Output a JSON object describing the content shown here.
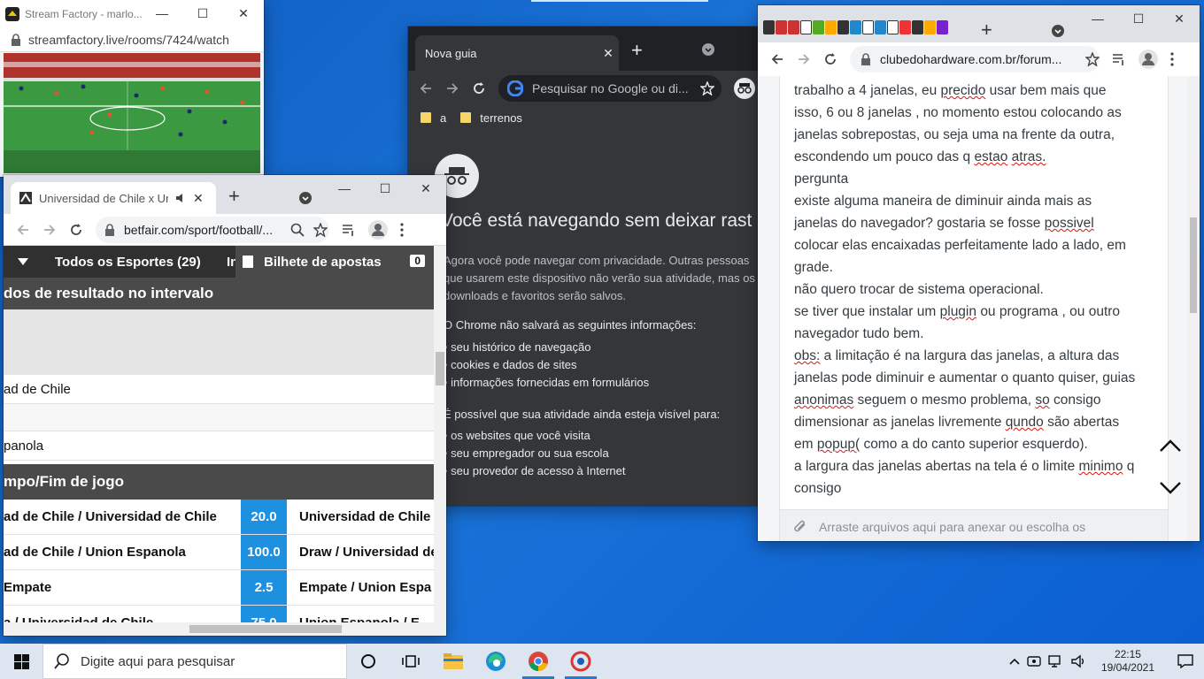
{
  "stream_window": {
    "title": "Stream Factory - marlo...",
    "url": "streamfactory.live/rooms/7424/watch"
  },
  "incognito_window": {
    "tab_title": "Nova guia",
    "omnibox_placeholder": "Pesquisar no Google ou di...",
    "bookmarks": [
      "a",
      "terrenos"
    ],
    "headline": "Você está navegando sem deixar rast",
    "intro": "Agora você pode navegar com privacidade. Outras pessoas que usarem este dispositivo não verão sua atividade, mas os downloads e favoritos serão salvos.",
    "not_saved_heading": "O Chrome não salvará as seguintes informações:",
    "not_saved_items": [
      "seu histórico de navegação",
      "cookies e dados de sites",
      "informações fornecidas em formulários"
    ],
    "visible_heading": "É possível que sua atividade ainda esteja visível para:",
    "visible_items": [
      "os websites que você visita",
      "seu empregador ou sua escola",
      "seu provedor de acesso à Internet"
    ]
  },
  "forum_window": {
    "url": "clubedohardware.com.br/forum...",
    "lines": [
      "trabalho a 4 janelas, eu precido usar bem mais que",
      "isso, 6 ou 8 janelas , no momento estou colocando as",
      "janelas sobrepostas, ou seja uma na frente da outra,",
      "escondendo um pouco das q estao atras.",
      "pergunta",
      "existe alguma maneira de diminuir ainda mais as",
      "janelas do navegador? gostaria se fosse possivel",
      "colocar elas encaixadas perfeitamente lado a lado, em",
      "grade.",
      "não quero trocar de sistema operacional.",
      "se tiver que instalar um plugin ou programa , ou outro",
      "navegador tudo bem.",
      "obs: a limitação é na largura das janelas, a altura das",
      "janelas pode diminuir e aumentar o quanto quiser, guias",
      "anonimas seguem o mesmo problema, so consigo",
      "dimensionar as janelas livremente qundo são abertas",
      "em popup( como a do canto superior esquerdo).",
      "a largura das janelas abertas na tela é o limite minimo q",
      "consigo"
    ],
    "attach_text": "Arraste arquivos aqui para anexar ou escolha os"
  },
  "betfair_window": {
    "tab_title": "Universidad de Chile x Union Espanola",
    "url": "betfair.com/sport/football/...",
    "nav": {
      "sports": "Todos os Esportes (29)",
      "more": "In",
      "bet_slip": "Bilhete de apostas",
      "slip_count": "0"
    },
    "section1": "dos de resultado no intervalo",
    "rows": [
      "ad de Chile",
      "",
      "panola"
    ],
    "section2": "mpo/Fim de jogo",
    "markets": [
      {
        "selection": "ad de Chile / Universidad de Chile",
        "odds": "20.0",
        "other": "Universidad de Chile"
      },
      {
        "selection": "ad de Chile / Union Espanola",
        "odds": "100.0",
        "other": "Draw / Universidad de"
      },
      {
        "selection": "Empate",
        "odds": "2.5",
        "other": "Empate / Union Espa"
      },
      {
        "selection": "a / Universidad de Chile",
        "odds": "75.0",
        "other": "Union Espanola / E"
      }
    ]
  },
  "taskbar": {
    "search_placeholder": "Digite aqui para pesquisar",
    "time": "22:15",
    "date": "19/04/2021"
  }
}
